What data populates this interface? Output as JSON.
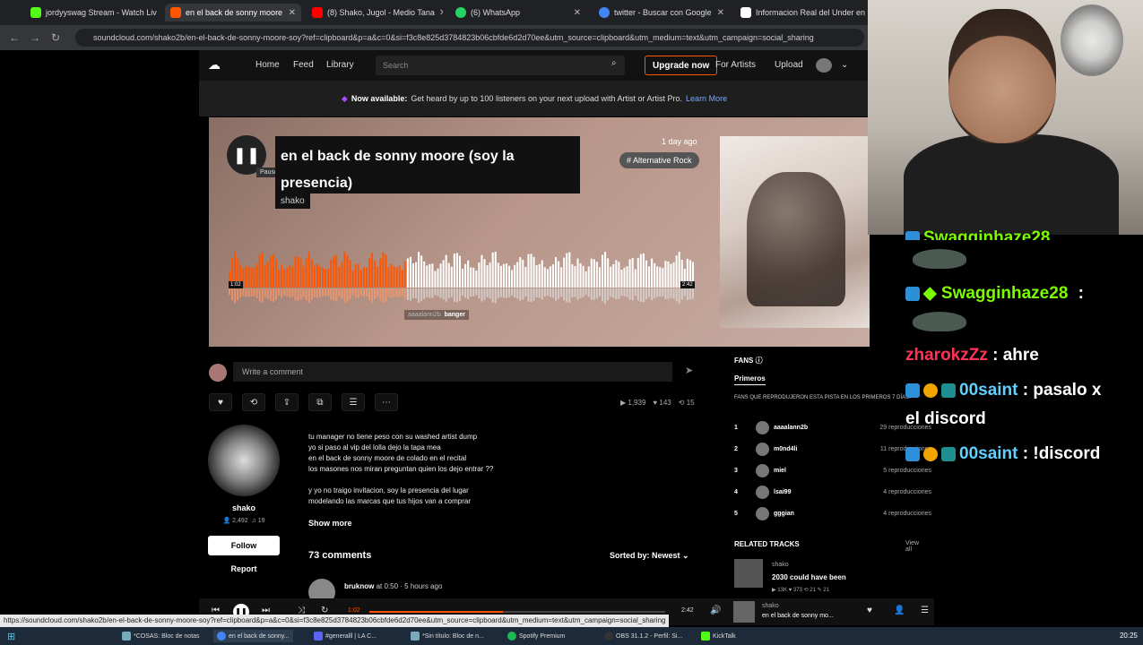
{
  "browser": {
    "tabs": [
      {
        "label": "jordyyswag Stream - Watch Liv",
        "color": "#53fc18",
        "active": false
      },
      {
        "label": "en el back de sonny moore",
        "color": "#ff5500",
        "active": true
      },
      {
        "label": "(8) Shako, Jugol - Medio Tana",
        "color": "#ff0000",
        "active": false
      },
      {
        "label": "(6) WhatsApp",
        "color": "#25d366",
        "active": false
      },
      {
        "label": "twitter - Buscar con Google",
        "color": "#4285f4",
        "active": false
      },
      {
        "label": "Informacion Real del Under en",
        "color": "#ffffff",
        "active": false
      }
    ],
    "url": "soundcloud.com/shako2b/en-el-back-de-sonny-moore-soy?ref=clipboard&p=a&c=0&si=f3c8e825d3784823b06cbfde6d2d70ee&utm_source=clipboard&utm_medium=text&utm_campaign=social_sharing",
    "status_url": "https://soundcloud.com/shako2b/en-el-back-de-sonny-moore-soy?ref=clipboard&p=a&c=0&si=f3c8e825d3784823b06cbfde6d2d70ee&utm_source=clipboard&utm_medium=text&utm_campaign=social_sharing"
  },
  "header": {
    "nav": [
      "Home",
      "Feed",
      "Library"
    ],
    "search_placeholder": "Search",
    "upgrade": "Upgrade now",
    "for_artists": "For Artists",
    "upload": "Upload"
  },
  "banner": {
    "bold": "Now available:",
    "text": "Get heard by up to 100 listeners on your next upload with Artist or Artist Pro.",
    "link": "Learn More"
  },
  "track": {
    "title": "en el back de sonny moore (soy la presencia)",
    "artist": "shako",
    "ago": "1 day ago",
    "tag": "# Alternative Rock",
    "tooltip": "Pause",
    "time_current": "1:02",
    "time_total": "2:42",
    "wave_comment_user": "aaaalann2b",
    "wave_comment": "banger",
    "progress_fraction": 0.38
  },
  "comment_box": {
    "placeholder": "Write a comment"
  },
  "stats": {
    "plays": "1,939",
    "likes": "143",
    "reposts": "15"
  },
  "uploader": {
    "name": "shako",
    "followers": "2,492",
    "tracks": "19",
    "follow": "Follow",
    "report": "Report"
  },
  "description": [
    "tu manager no tiene peso con su washed artist dump",
    "yo si paso al vip del lolla dejo la tapa mea",
    "en el back de sonny moore de colado en el recital",
    "los masones nos miran preguntan quien los dejo entrar ??",
    "",
    "y yo no traigo invitacion, soy la presencia del lugar",
    "modelando las marcas que tus hijos van a comprar"
  ],
  "show_more": "Show more",
  "comments": {
    "count": "73 comments",
    "sorted": "Sorted by: Newest",
    "first_user": "bruknow",
    "first_meta": "at 0:50 · 5 hours ago"
  },
  "fans": {
    "title": "FANS",
    "tab": "Primeros",
    "subtitle": "FANS QUE REPRODUJERON ESTA PISTA EN LOS PRIMEROS 7 DÍAS:",
    "list": [
      {
        "rank": "1",
        "name": "aaaalann2b",
        "plays": "29 reproducciones"
      },
      {
        "rank": "2",
        "name": "m0nd4li",
        "plays": "11 reproducciones"
      },
      {
        "rank": "3",
        "name": "miel",
        "plays": "5 reproducciones"
      },
      {
        "rank": "4",
        "name": "lsai99",
        "plays": "4 reproducciones"
      },
      {
        "rank": "5",
        "name": "gggian",
        "plays": "4 reproducciones"
      }
    ]
  },
  "related": {
    "title": "RELATED TRACKS",
    "view_all": "View all",
    "artist": "shako",
    "track": "2030 could have been",
    "stats": "▶ 13K  ♥ 373  ⟲ 21  ✎ 21"
  },
  "player": {
    "time": "1:02",
    "duration": "2:42",
    "artist": "shako",
    "title": "en el back de sonny mo..."
  },
  "taskbar": {
    "items": [
      "*COSAS: Bloc de notas",
      "en el back de sonny...",
      "#generalll | LA C...",
      "*Sin título: Bloc de n...",
      "Spotify Premium",
      "OBS 31.1.2 - Perfil: Si...",
      "KickTalk"
    ],
    "clock": "20:25"
  },
  "chat": [
    {
      "user": "Swagginhaze28",
      "msg": "",
      "color": "#7CFC00"
    },
    {
      "user": "Swagginhaze28",
      "msg": " :",
      "color": "#7CFC00"
    },
    {
      "user": "zharokzZz",
      "msg": " : ahre",
      "color": "#ff3355"
    },
    {
      "user": "00saint",
      "msg": " : pasalo x",
      "color": "#5fd0ff"
    },
    {
      "user": "",
      "msg": "el discord",
      "color": "#ffffff"
    },
    {
      "user": "00saint",
      "msg": " : !discord",
      "color": "#5fd0ff"
    }
  ]
}
